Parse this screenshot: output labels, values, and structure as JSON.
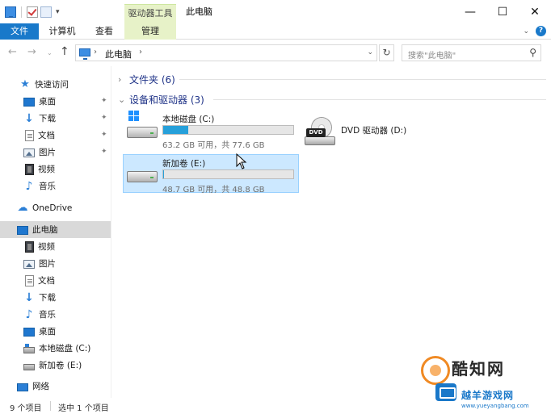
{
  "window": {
    "title": "此电脑",
    "context_tab_group": "驱动器工具",
    "controls": {
      "minimize": "—",
      "maximize": "☐",
      "close": "✕"
    }
  },
  "quick_access_toolbar": {
    "dropdown_glyph": "▾"
  },
  "ribbon": {
    "tabs": [
      "文件",
      "计算机",
      "查看",
      "管理"
    ],
    "active_tab": "文件",
    "expand_glyph": "⌄",
    "help_glyph": "?"
  },
  "navigation": {
    "back_glyph": "←",
    "forward_glyph": "→",
    "recent_glyph": "⌄",
    "up_glyph": "↑",
    "breadcrumb": [
      "此电脑"
    ],
    "crumb_separator": "›",
    "dropdown_glyph": "⌄",
    "refresh_glyph": "↻",
    "search_placeholder": "搜索\"此电脑\"",
    "search_glyph": "⚲"
  },
  "sidebar": {
    "pin_glyph": "✦",
    "quick_access": {
      "label": "快速访问",
      "items": [
        {
          "label": "桌面",
          "icon": "desktop-icon",
          "pinned": true
        },
        {
          "label": "下载",
          "icon": "download-icon",
          "pinned": true
        },
        {
          "label": "文档",
          "icon": "document-icon",
          "pinned": true
        },
        {
          "label": "图片",
          "icon": "picture-icon",
          "pinned": true
        },
        {
          "label": "视频",
          "icon": "video-icon",
          "pinned": false
        },
        {
          "label": "音乐",
          "icon": "music-icon",
          "pinned": false
        }
      ]
    },
    "onedrive": {
      "label": "OneDrive"
    },
    "this_pc": {
      "label": "此电脑",
      "items": [
        {
          "label": "视频",
          "icon": "video-icon"
        },
        {
          "label": "图片",
          "icon": "picture-icon"
        },
        {
          "label": "文档",
          "icon": "document-icon"
        },
        {
          "label": "下载",
          "icon": "download-icon"
        },
        {
          "label": "音乐",
          "icon": "music-icon"
        },
        {
          "label": "桌面",
          "icon": "desktop-icon"
        },
        {
          "label": "本地磁盘 (C:)",
          "icon": "drive-c-icon"
        },
        {
          "label": "新加卷 (E:)",
          "icon": "drive-icon"
        }
      ]
    },
    "network": {
      "label": "网络"
    }
  },
  "content": {
    "folders_group": {
      "label": "文件夹 (6)",
      "expanded": false,
      "glyph": "›"
    },
    "drives_group": {
      "label": "设备和驱动器 (3)",
      "expanded": true,
      "glyph": "⌄"
    },
    "drives": [
      {
        "name": "本地磁盘 (C:)",
        "space_text": "63.2 GB 可用，共 77.6 GB",
        "used_fraction": 0.19,
        "selected": false
      },
      {
        "name": "新加卷 (E:)",
        "space_text": "48.7 GB 可用，共 48.8 GB",
        "used_fraction": 0.002,
        "selected": true
      }
    ],
    "dvd": {
      "name": "DVD 驱动器 (D:)",
      "badge": "DVD"
    }
  },
  "status": {
    "item_count": "9 个项目",
    "selection": "选中 1 个项目"
  },
  "watermark": {
    "title": "酷知网",
    "subtitle": "越羊游戏网",
    "url": "www.yueyangbang.com"
  },
  "colors": {
    "accent": "#1979ca",
    "context_tab": "#e7f2c8",
    "selection": "#cce8ff",
    "progress": "#26a0da",
    "group_header": "#1e3287"
  }
}
